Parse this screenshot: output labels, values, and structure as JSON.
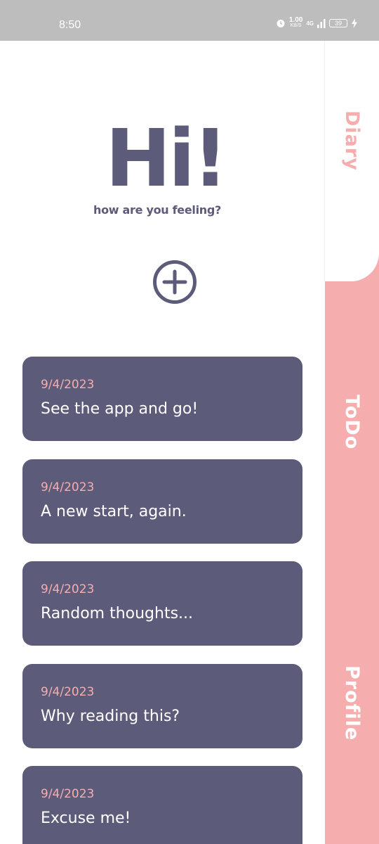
{
  "status_bar": {
    "time": "8:50",
    "net_speed_value": "1.00",
    "net_speed_unit": "KB/S",
    "network_type": "4G",
    "battery_level": "39",
    "icons": [
      "alarm-icon",
      "signal-icon",
      "battery-icon",
      "charging-bolt-icon"
    ]
  },
  "greeting": {
    "headline": "Hi!",
    "subheading": "how are you feeling?"
  },
  "add_button": {
    "icon": "plus-circle-icon"
  },
  "entries": [
    {
      "date": "9/4/2023",
      "title": "See the app and go!"
    },
    {
      "date": "9/4/2023",
      "title": "A new start, again."
    },
    {
      "date": "9/4/2023",
      "title": "Random thoughts..."
    },
    {
      "date": "9/4/2023",
      "title": "Why reading this?"
    },
    {
      "date": "9/4/2023",
      "title": "Excuse me!"
    }
  ],
  "tabs": [
    {
      "label": "Diary",
      "active": true
    },
    {
      "label": "ToDo",
      "active": false
    },
    {
      "label": "Profile",
      "active": false
    }
  ],
  "colors": {
    "primary": "#5d5b7a",
    "accent": "#f6adae",
    "background": "#ffffff",
    "status_bar": "#bdbdbd"
  }
}
